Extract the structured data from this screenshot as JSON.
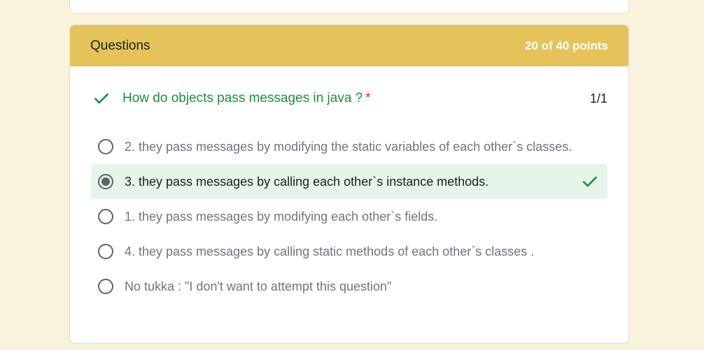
{
  "section": {
    "title": "Questions",
    "score": "20 of 40 points"
  },
  "question": {
    "text": "How do objects pass messages in java ?",
    "required_mark": "*",
    "score": "1/1",
    "status_icon": "check-icon"
  },
  "options": [
    {
      "label": "2. they pass messages by modifying the static variables of each other`s classes.",
      "selected": false
    },
    {
      "label": "3. they pass messages by calling each other`s instance methods.",
      "selected": true,
      "correct": true
    },
    {
      "label": "1. they pass messages by modifying each other`s fields.",
      "selected": false
    },
    {
      "label": "4. they pass messages by calling static methods of each other`s classes .",
      "selected": false
    },
    {
      "label": "No tukka : \"I don't want to attempt this question\"",
      "selected": false
    }
  ],
  "colors": {
    "page_background": "#f9f2dc",
    "header_background": "#e6c25a",
    "correct_green": "#1e8e3e",
    "selected_background": "#e6f4ea",
    "required_red": "#d93025"
  }
}
